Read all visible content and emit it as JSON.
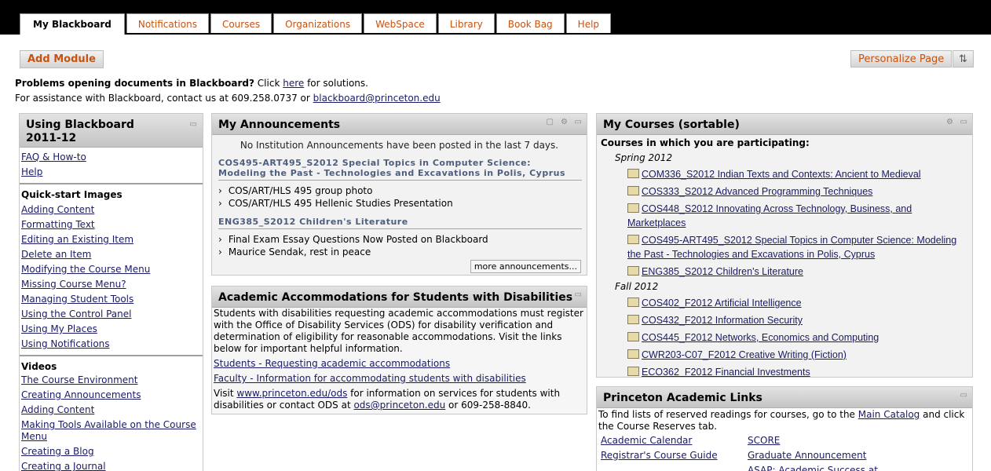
{
  "nav": {
    "tabs": [
      "My Blackboard",
      "Notifications",
      "Courses",
      "Organizations",
      "WebSpace",
      "Library",
      "Book Bag",
      "Help"
    ]
  },
  "toolbar": {
    "add_module": "Add Module",
    "personalize": "Personalize Page",
    "sort_icon": "⇅"
  },
  "notice": {
    "problems_bold": "Problems opening documents in Blackboard?",
    "click": " Click ",
    "here": "here",
    "solutions": " for solutions.",
    "assist": "For assistance with Blackboard, contact us at 609.258.0737 or ",
    "email": "blackboard@princeton.edu"
  },
  "using_bb": {
    "title": "Using Blackboard 2011-12",
    "top_links": [
      "FAQ & How-to",
      "Help"
    ],
    "quick_title": "Quick-start Images",
    "quick_links": [
      "Adding Content",
      "Formatting Text",
      "Editing an Existing Item",
      "Delete an Item",
      "Modifying the Course Menu",
      "Missing Course Menu?",
      "Managing Student Tools",
      "Using the Control Panel",
      "Using My Places",
      "Using Notifications"
    ],
    "videos_title": "Videos",
    "video_links": [
      "The Course Environment",
      "Creating Announcements",
      "Adding Content",
      "Making Tools Available on the Course Menu",
      "Creating a Blog",
      "Creating a Journal"
    ]
  },
  "announcements": {
    "title": "My Announcements",
    "none": "No Institution Announcements have been posted in the last 7 days.",
    "groups": [
      {
        "course": "COS495-ART495_S2012 Special Topics in Computer Science: Modeling the Past - Technologies and Excavations in Polis, Cyprus",
        "items": [
          "COS/ART/HLS 495 group photo",
          "COS/ART/HLS 495 Hellenic Studies Presentation"
        ]
      },
      {
        "course": "ENG385_S2012 Children's Literature",
        "items": [
          "Final Exam Essay Questions Now Posted on Blackboard",
          "Maurice Sendak, rest in peace"
        ]
      }
    ],
    "more": "more announcements..."
  },
  "accommodations": {
    "title": "Academic Accommodations for Students with Disabilities",
    "text": "Students with disabilities requesting academic accommodations must register with the Office of Disability Services (ODS)  for disability verification and determination of eligibility for reasonable accommodations.  Visit the links below for important helpful information.",
    "link1": "Students - Requesting academic accommodations",
    "link2": "Faculty - Information for accommodating students with disabilities",
    "visit": "Visit ",
    "ods_url": "www.princeton.edu/ods",
    "mid": " for information on services for students with disabilities or contact ODS at ",
    "ods_email": "ods@princeton.edu",
    "tail": " or 609-258-8840."
  },
  "my_courses": {
    "title": "My Courses (sortable)",
    "header": "Courses in which you are participating:",
    "terms": [
      {
        "name": "Spring 2012",
        "courses": [
          "COM336_S2012 Indian Texts and Contexts: Ancient to Medieval",
          "COS333_S2012 Advanced Programming Techniques",
          "COS448_S2012 Innovating Across Technology, Business, and Marketplaces",
          "COS495-ART495_S2012 Special Topics in Computer Science: Modeling the Past - Technologies and Excavations in Polis, Cyprus",
          "ENG385_S2012 Children's Literature"
        ]
      },
      {
        "name": "Fall 2012",
        "courses": [
          "COS402_F2012 Artificial Intelligence",
          "COS432_F2012 Information Security",
          "COS445_F2012 Networks, Economics and Computing",
          "CWR203-C07_F2012 Creative Writing (Fiction)",
          "ECO362_F2012 Financial Investments"
        ]
      }
    ]
  },
  "academic_links": {
    "title": "Princeton Academic Links",
    "text_a": "To find lists of reserved readings for courses, go to the ",
    "catalog": "Main Catalog",
    "text_b": " and click the Course Reserves tab.",
    "links": [
      "Academic Calendar",
      "SCORE",
      "Registrar's Course Guide",
      "Graduate Announcement",
      "",
      "ASAP: Academic Success at"
    ]
  }
}
